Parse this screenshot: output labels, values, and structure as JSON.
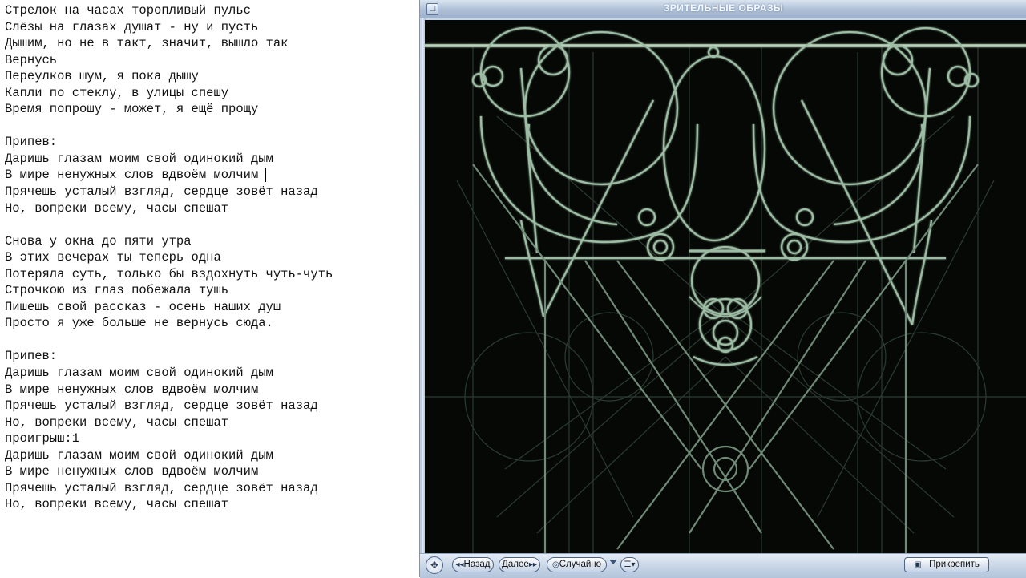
{
  "editor": {
    "lines": [
      "Стрелок на часах торопливый пульс",
      "Слёзы на глазах душат - ну и пусть",
      "Дышим, но не в такт, значит, вышло так",
      "Вернусь",
      "Переулков шум, я пока дышу",
      "Капли по стеклу, в улицы спешу",
      "Время попрошу - может, я ещё прощу",
      "",
      "Припев:",
      "Даришь глазам моим свой одинокий дым",
      "В мире ненужных слов вдвоём молчим",
      "Прячешь усталый взгляд, сердце зовёт назад",
      "Но, вопреки всему, часы спешат",
      "",
      "Снова у окна до пяти утра",
      "В этих вечерах ты теперь одна",
      "Потеряла суть, только бы вздохнуть чуть-чуть",
      "Строчкою из глаз побежала тушь",
      "Пишешь свой рассказ - осень наших душ",
      "Просто я уже больше не вернусь сюда.",
      "",
      "Припев:",
      "Даришь глазам моим свой одинокий дым",
      "В мире ненужных слов вдвоём молчим",
      "Прячешь усталый взгляд, сердце зовёт назад",
      "Но, вопреки всему, часы спешат",
      "проигрыш:1",
      "Даришь глазам моим свой одинокий дым",
      "В мире ненужных слов вдвоём молчим",
      "Прячешь усталый взгляд, сердце зовёт назад",
      "Но, вопреки всему, часы спешат"
    ]
  },
  "visualizer": {
    "title": "ЗРИТЕЛЬНЫЕ ОБРАЗЫ",
    "line_color": "#9fbfa6",
    "background_color": "#050805"
  },
  "controls": {
    "back": {
      "icon": "double-left-arrow-icon",
      "label": "Назад"
    },
    "next": {
      "icon": "double-right-arrow-icon",
      "label": "Далее"
    },
    "random": {
      "icon": "shuffle-circle-icon",
      "label": "Случайно"
    },
    "pin": {
      "icon": "pin-window-icon",
      "label": "Прикрепить"
    }
  }
}
